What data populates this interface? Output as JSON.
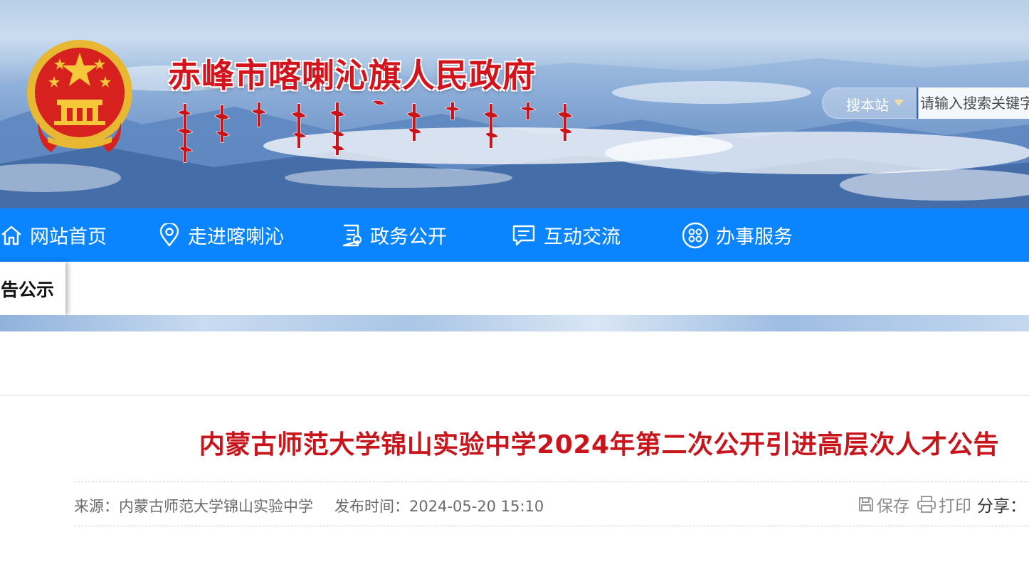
{
  "header": {
    "site_title": "赤峰市喀喇沁旗人民政府"
  },
  "search": {
    "scope_label": "搜本站",
    "placeholder": "请输入搜索关键字"
  },
  "nav": {
    "items": [
      {
        "label": "网站首页",
        "icon": "home-icon"
      },
      {
        "label": "走进喀喇沁",
        "icon": "location-pin-icon"
      },
      {
        "label": "政务公开",
        "icon": "document-icon"
      },
      {
        "label": "互动交流",
        "icon": "chat-icon"
      },
      {
        "label": "办事服务",
        "icon": "services-grid-icon"
      }
    ]
  },
  "breadcrumb": {
    "current": "告公示"
  },
  "article": {
    "title": "内蒙古师范大学锦山实验中学2024年第二次公开引进高层次人才公告",
    "source": "来源：内蒙古师范大学锦山实验中学",
    "publish_time": "发布时间：2024-05-20 15:10",
    "save_label": "保存",
    "print_label": "打印",
    "share_label": "分享："
  },
  "colors": {
    "nav_bg": "#0a84ff",
    "title_red": "#c8151c",
    "site_title_red": "#d4141c"
  }
}
